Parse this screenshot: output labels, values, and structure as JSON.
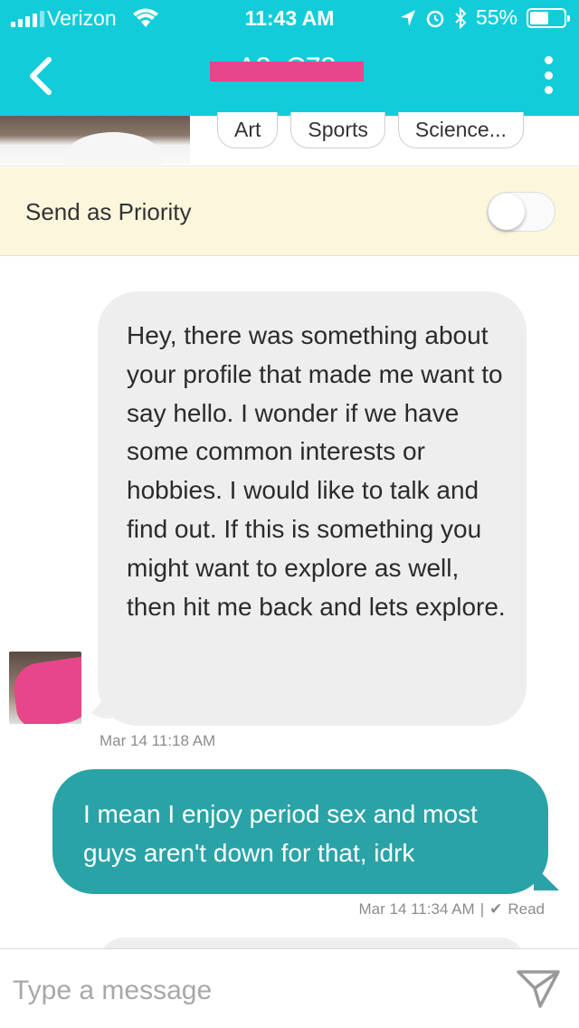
{
  "status": {
    "carrier": "Verizon",
    "time": "11:43 AM",
    "battery": "55%",
    "battery_level": 0.55
  },
  "header": {
    "title": "A8_C78",
    "accent_color": "#12cdd9",
    "redaction_color": "#e8468a"
  },
  "profile": {
    "tags": [
      "Art",
      "Sports",
      "Science..."
    ]
  },
  "priority": {
    "label": "Send as Priority",
    "enabled": false
  },
  "messages": [
    {
      "direction": "incoming",
      "text": "Hey, there was something about your profile that made me want to say hello. I wonder if we have some common interests or hobbies. I would like to talk and find out. If this is something you might want to explore as well, then hit me back and lets explore.",
      "timestamp": "Mar 14 11:18 AM",
      "bubble_color": "#eeeeee"
    },
    {
      "direction": "outgoing",
      "text": "I mean I enjoy period sex and most guys aren't down for that, idrk",
      "timestamp": "Mar 14 11:34 AM",
      "read_status": "Read",
      "bubble_color": "#2aa3a7"
    }
  ],
  "composer": {
    "placeholder": "Type a message"
  },
  "icons": {
    "back": "chevron-left-icon",
    "menu": "more-vertical-icon",
    "send": "send-icon",
    "location": "location-arrow-icon",
    "alarm": "alarm-icon",
    "bluetooth": "bluetooth-icon",
    "wifi": "wifi-icon"
  }
}
